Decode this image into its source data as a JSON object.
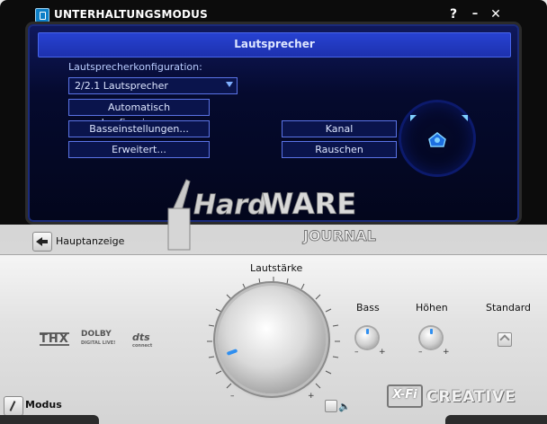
{
  "window": {
    "title": "UNTERHALTUNGSMODUS",
    "help_label": "?",
    "minimize_label": "–",
    "close_label": "✕"
  },
  "panel": {
    "title": "Lautsprecher",
    "config_label": "Lautsprecherkonfiguration:",
    "config_value": "2/2.1 Lautsprecher",
    "buttons": {
      "auto": "Automatisch konfigurieren...",
      "bass": "Basseinstellungen...",
      "advanced": "Erweitert...",
      "channel": "Kanal",
      "noise": "Rauschen"
    }
  },
  "watermark": {
    "line1_a": "Hard",
    "line1_b": "WARE",
    "line2": "JOURNAL"
  },
  "nav": {
    "home_label": "Hauptanzeige"
  },
  "controls": {
    "volume_label": "Lautstärke",
    "bass_label": "Bass",
    "treble_label": "Höhen",
    "standard_label": "Standard",
    "minus": "–",
    "plus": "+"
  },
  "logos": {
    "thx": "THX",
    "dolby": "DOLBY",
    "dolby_sub": "DIGITAL LIVE!",
    "dts": "dts",
    "dts_sub": "connect",
    "xfi": "X-Fi",
    "creative": "CREATIVE"
  },
  "footer": {
    "mode_label": "Modus",
    "speaker_icon": "🔈"
  },
  "icons": {
    "app": "app-icon",
    "home": "back-arrow-icon",
    "mode": "mode-icon"
  },
  "colors": {
    "accent_blue": "#2742d2",
    "indicator": "#2f8ff0"
  }
}
